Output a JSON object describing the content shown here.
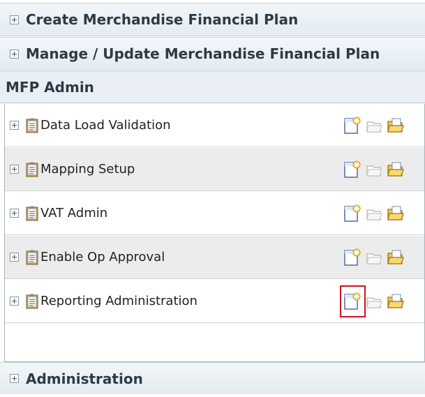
{
  "sections": {
    "create": {
      "label": "Create Merchandise Financial Plan"
    },
    "manage": {
      "label": "Manage / Update Merchandise Financial Plan"
    },
    "admin": {
      "label": "MFP Admin"
    },
    "administration": {
      "label": "Administration"
    }
  },
  "tasks": [
    {
      "label": "Data Load Validation"
    },
    {
      "label": "Mapping Setup"
    },
    {
      "label": "VAT Admin"
    },
    {
      "label": "Enable Op Approval"
    },
    {
      "label": "Reporting Administration"
    }
  ],
  "icons": {
    "expand": "plus-box-icon",
    "task": "clipboard-icon",
    "new": "new-workbook-icon",
    "open_disabled": "open-workbook-disabled-icon",
    "folder": "open-folder-icon"
  },
  "colors": {
    "highlight": "#d0101c",
    "header_text": "#2d3b46",
    "alt_row": "#ececec"
  }
}
